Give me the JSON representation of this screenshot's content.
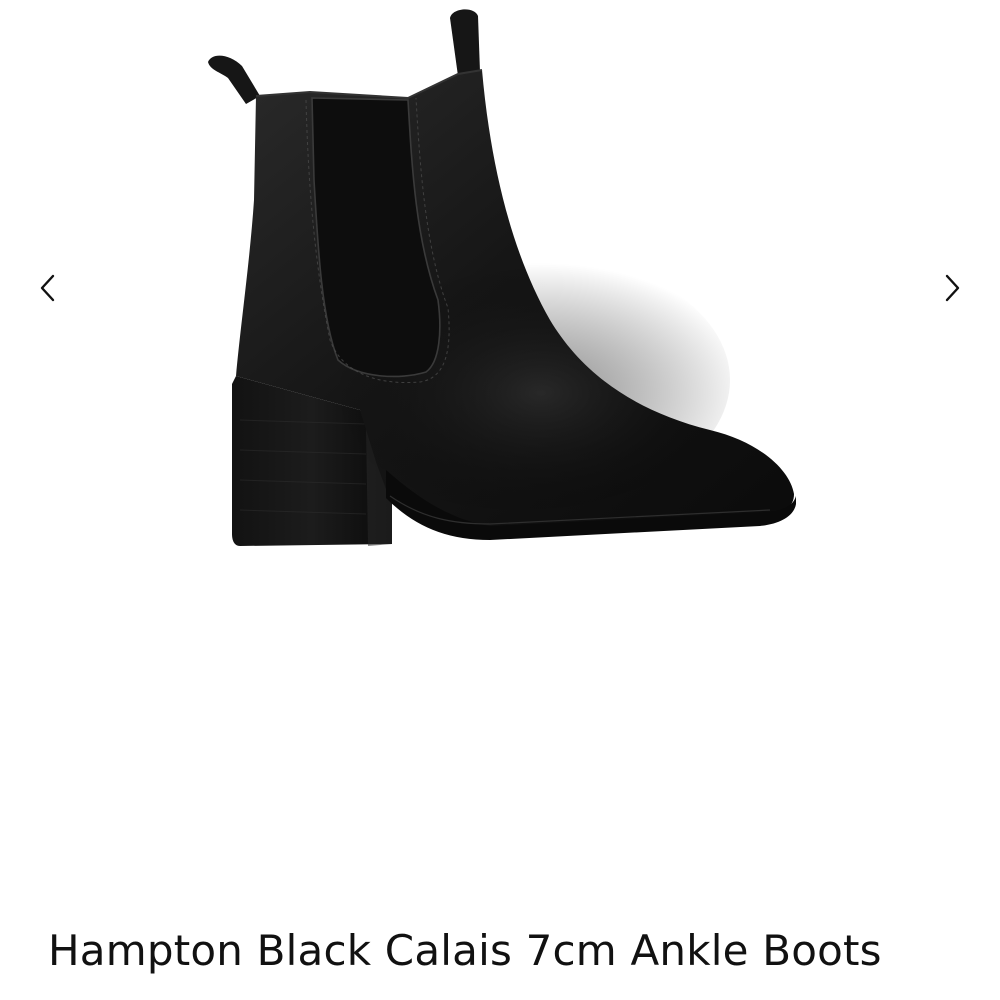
{
  "gallery": {
    "image": {
      "icon": "ankle-boot-photo"
    },
    "prev_icon": "chevron-left-icon",
    "next_icon": "chevron-right-icon"
  },
  "product": {
    "title": "Hampton Black Calais 7cm Ankle Boots"
  }
}
